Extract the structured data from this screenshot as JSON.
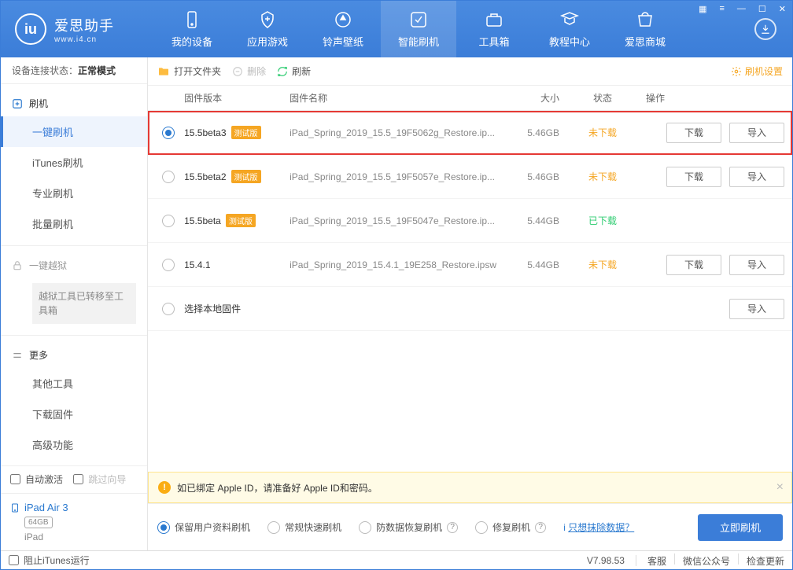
{
  "window": {
    "app_name": "爱思助手",
    "app_url": "www.i4.cn",
    "conn_label": "设备连接状态：",
    "conn_value": "正常模式"
  },
  "nav": [
    {
      "label": "我的设备"
    },
    {
      "label": "应用游戏"
    },
    {
      "label": "铃声壁纸"
    },
    {
      "label": "智能刷机"
    },
    {
      "label": "工具箱"
    },
    {
      "label": "教程中心"
    },
    {
      "label": "爱思商城"
    }
  ],
  "sidebar": {
    "groups": [
      {
        "title": "刷机",
        "items": [
          "一键刷机",
          "iTunes刷机",
          "专业刷机",
          "批量刷机"
        ]
      },
      {
        "title": "一键越狱",
        "note": "越狱工具已转移至工具箱",
        "dim": true
      },
      {
        "title": "更多",
        "items": [
          "其他工具",
          "下载固件",
          "高级功能"
        ]
      }
    ],
    "auto_activate": "自动激活",
    "skip_guide": "跳过向导"
  },
  "device": {
    "name": "iPad Air 3",
    "capacity": "64GB",
    "type": "iPad"
  },
  "toolbar": {
    "open": "打开文件夹",
    "delete": "删除",
    "refresh": "刷新",
    "settings": "刷机设置"
  },
  "table": {
    "headers": {
      "version": "固件版本",
      "name": "固件名称",
      "size": "大小",
      "status": "状态",
      "op": "操作"
    },
    "rows": [
      {
        "version": "15.5beta3",
        "beta": "测试版",
        "name": "iPad_Spring_2019_15.5_19F5062g_Restore.ip...",
        "size": "5.46GB",
        "status": "未下载",
        "status_cls": "st-nodl",
        "ops": [
          "下载",
          "导入"
        ],
        "selected": true,
        "highlight": true
      },
      {
        "version": "15.5beta2",
        "beta": "测试版",
        "name": "iPad_Spring_2019_15.5_19F5057e_Restore.ip...",
        "size": "5.46GB",
        "status": "未下载",
        "status_cls": "st-nodl",
        "ops": [
          "下载",
          "导入"
        ]
      },
      {
        "version": "15.5beta",
        "beta": "测试版",
        "name": "iPad_Spring_2019_15.5_19F5047e_Restore.ip...",
        "size": "5.44GB",
        "status": "已下载",
        "status_cls": "st-dl",
        "ops": []
      },
      {
        "version": "15.4.1",
        "beta": "",
        "name": "iPad_Spring_2019_15.4.1_19E258_Restore.ipsw",
        "size": "5.44GB",
        "status": "未下载",
        "status_cls": "st-nodl",
        "ops": [
          "下载",
          "导入"
        ]
      },
      {
        "version": "选择本地固件",
        "beta": "",
        "name": "",
        "size": "",
        "status": "",
        "status_cls": "",
        "ops": [
          "导入"
        ]
      }
    ]
  },
  "alert": "如已绑定 Apple ID，请准备好 Apple ID和密码。",
  "options": {
    "items": [
      "保留用户资料刷机",
      "常规快速刷机",
      "防数据恢复刷机",
      "修复刷机"
    ],
    "link": "只想抹除数据？",
    "submit": "立即刷机"
  },
  "footer": {
    "block_itunes": "阻止iTunes运行",
    "version": "V7.98.53",
    "links": [
      "客服",
      "微信公众号",
      "检查更新"
    ]
  }
}
